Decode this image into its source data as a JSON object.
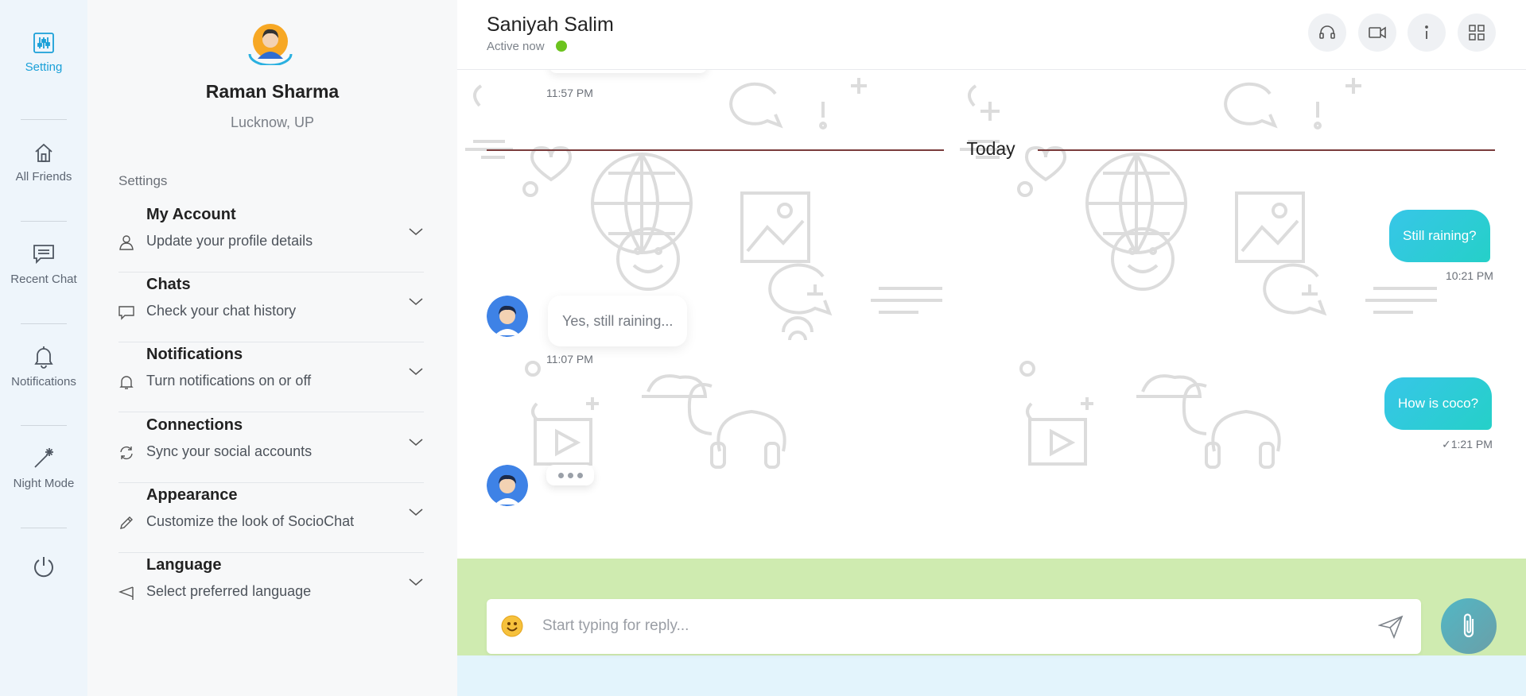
{
  "rail": {
    "items": [
      {
        "label": "Setting",
        "icon": "sliders-icon",
        "active": true
      },
      {
        "label": "All Friends",
        "icon": "home-icon"
      },
      {
        "label": "Recent Chat",
        "icon": "chat-icon"
      },
      {
        "label": "Notifications",
        "icon": "bell-icon"
      },
      {
        "label": "Night Mode",
        "icon": "magic-wand-icon"
      }
    ],
    "power_icon": "power-icon"
  },
  "settings": {
    "profile": {
      "name": "Raman Sharma",
      "location": "Lucknow, UP"
    },
    "heading": "Settings",
    "items": [
      {
        "title": "My Account",
        "desc": "Update your profile details",
        "icon": "user-icon"
      },
      {
        "title": "Chats",
        "desc": "Check your chat history",
        "icon": "chat-bubble-icon"
      },
      {
        "title": "Notifications",
        "desc": "Turn notifications on or off",
        "icon": "bell-icon"
      },
      {
        "title": "Connections",
        "desc": "Sync your social accounts",
        "icon": "sync-icon"
      },
      {
        "title": "Appearance",
        "desc": "Customize the look of SocioChat",
        "icon": "pencil-icon"
      },
      {
        "title": "Language",
        "desc": "Select preferred language",
        "icon": "flag-icon"
      }
    ]
  },
  "chat": {
    "contact": {
      "name": "Saniyah Salim",
      "status": "Active now"
    },
    "header_buttons": [
      "headset-icon",
      "video-icon",
      "info-icon",
      "grid-icon"
    ],
    "divider": "Today",
    "messages": [
      {
        "dir": "in",
        "text": "",
        "time": "11:57 PM"
      },
      {
        "dir": "out",
        "text": "Still raining?",
        "time": "10:21 PM"
      },
      {
        "dir": "in",
        "text": "Yes, still raining...",
        "time": "11:07 PM"
      },
      {
        "dir": "out",
        "text": "How is coco?",
        "time": "✓1:21 PM"
      }
    ],
    "composer": {
      "placeholder": "Start typing for reply..."
    },
    "colors": {
      "out_bubble": "#2ecbd8",
      "composer_band": "#cfebb0",
      "status_online": "#6cc31e"
    }
  }
}
